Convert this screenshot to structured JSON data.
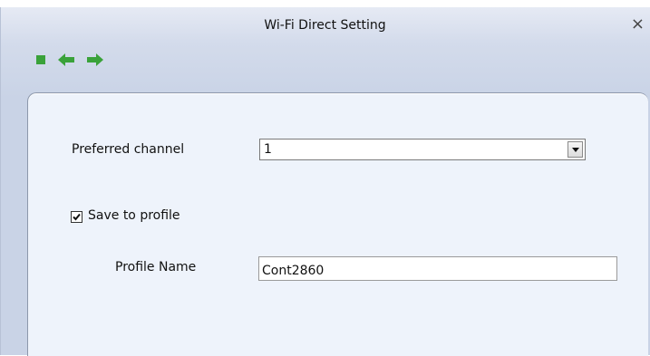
{
  "window": {
    "title": "Wi-Fi Direct Setting",
    "close_glyph": "×"
  },
  "toolbar": {
    "icons": [
      "stop-icon",
      "back-arrow-icon",
      "forward-arrow-icon"
    ],
    "icon_color": "#3aa23a"
  },
  "form": {
    "preferred_channel_label": "Preferred channel",
    "preferred_channel_value": "1",
    "save_to_profile_label": "Save to profile",
    "save_to_profile_checked": true,
    "profile_name_label": "Profile Name",
    "profile_name_value": "Cont2860"
  }
}
